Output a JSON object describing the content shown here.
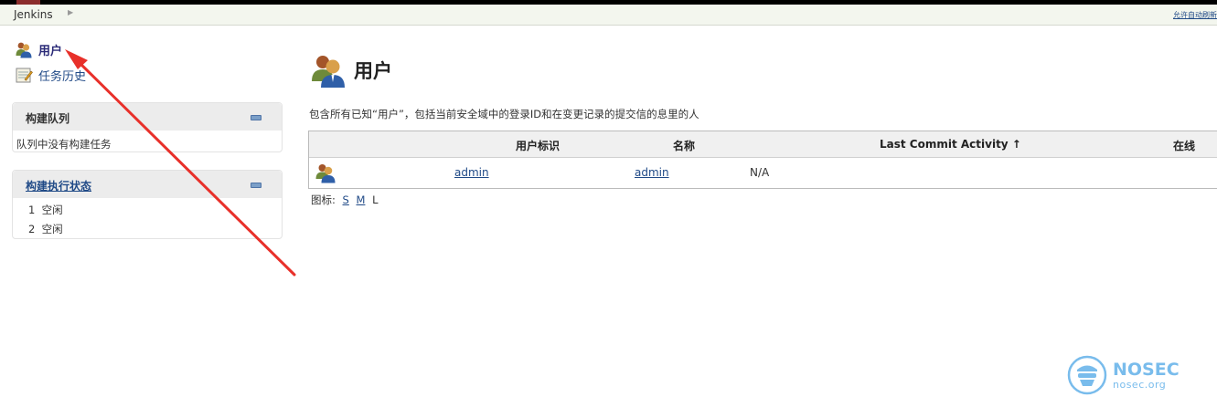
{
  "breadcrumb": {
    "root": "Jenkins",
    "auto_refresh": "允许自动刷新"
  },
  "sidebar": {
    "tasks": [
      {
        "label": "用户",
        "icon": "users-icon"
      },
      {
        "label": "任务历史",
        "icon": "notepad-icon"
      }
    ],
    "build_queue": {
      "title": "构建队列",
      "empty_text": "队列中没有构建任务"
    },
    "executors": {
      "title": "构建执行状态",
      "items": [
        {
          "number": "1",
          "status": "空闲"
        },
        {
          "number": "2",
          "status": "空闲"
        }
      ]
    }
  },
  "main": {
    "title": "用户",
    "description": "包含所有已知“用户”，包括当前安全域中的登录ID和在变更记录的提交信的息里的人",
    "table": {
      "headers": {
        "user_id": "用户标识",
        "name": "名称",
        "last_commit": "Last Commit Activity ↑",
        "online": "在线"
      },
      "rows": [
        {
          "user_id": "admin",
          "name": "admin",
          "last_commit": "N/A",
          "online": ""
        }
      ]
    },
    "icon_size": {
      "label": "图标:",
      "options": [
        "S",
        "M",
        "L"
      ]
    }
  },
  "watermark": {
    "name": "NOSEC",
    "domain": "nosec.org"
  },
  "colors": {
    "annotation_arrow": "#e8302a",
    "link": "#204a87",
    "watermark": "#4da6e6"
  }
}
